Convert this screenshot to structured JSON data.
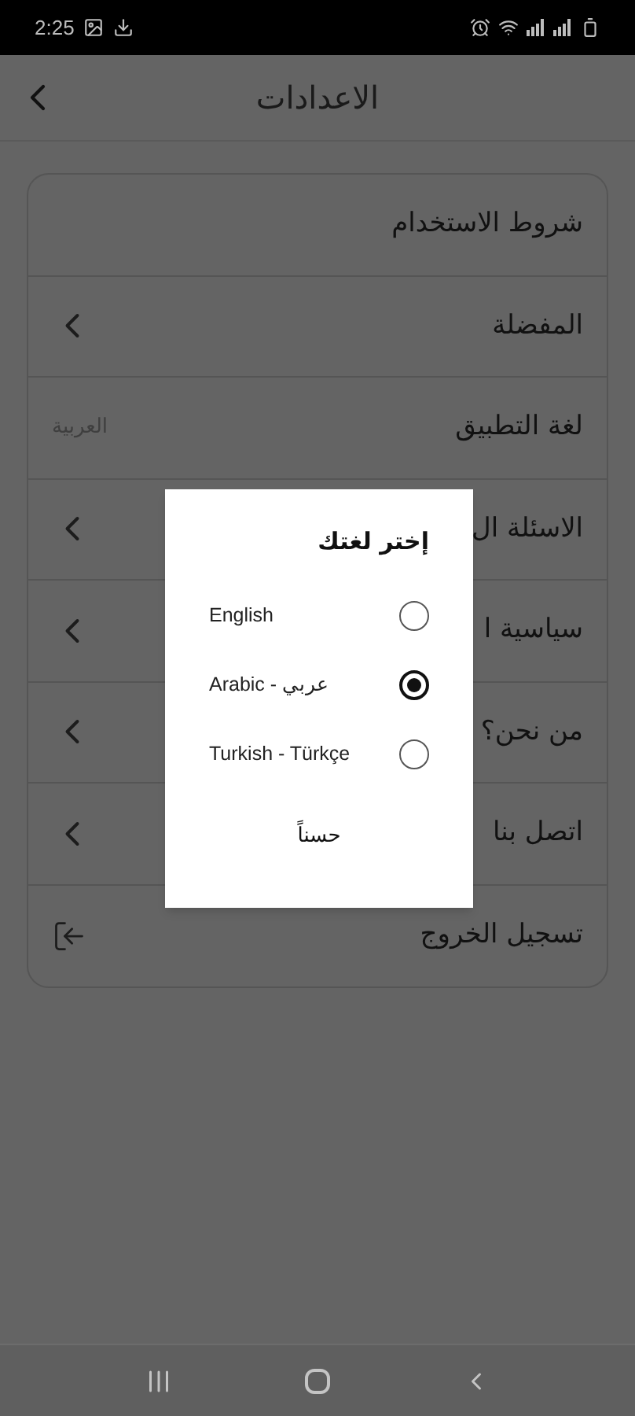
{
  "status_bar": {
    "time": "2:25"
  },
  "header": {
    "title": "الاعدادات"
  },
  "settings": [
    {
      "label": "شروط الاستخدام",
      "kind": "plain"
    },
    {
      "label": "المفضلة",
      "kind": "chevron"
    },
    {
      "label": "لغة التطبيق",
      "kind": "value",
      "value": "العربية"
    },
    {
      "label": "الاسئلة ال",
      "kind": "chevron"
    },
    {
      "label": "سياسية ا",
      "kind": "chevron"
    },
    {
      "label": "من نحن؟",
      "kind": "chevron"
    },
    {
      "label": "اتصل بنا",
      "kind": "chevron"
    },
    {
      "label": "تسجيل الخروج",
      "kind": "logout"
    }
  ],
  "dialog": {
    "title": "إختر لغتك",
    "options": [
      {
        "label": "English",
        "selected": false
      },
      {
        "label": "Arabic - عربي",
        "selected": true
      },
      {
        "label": "Turkish - Türkçe",
        "selected": false
      }
    ],
    "button": "حسناً"
  }
}
